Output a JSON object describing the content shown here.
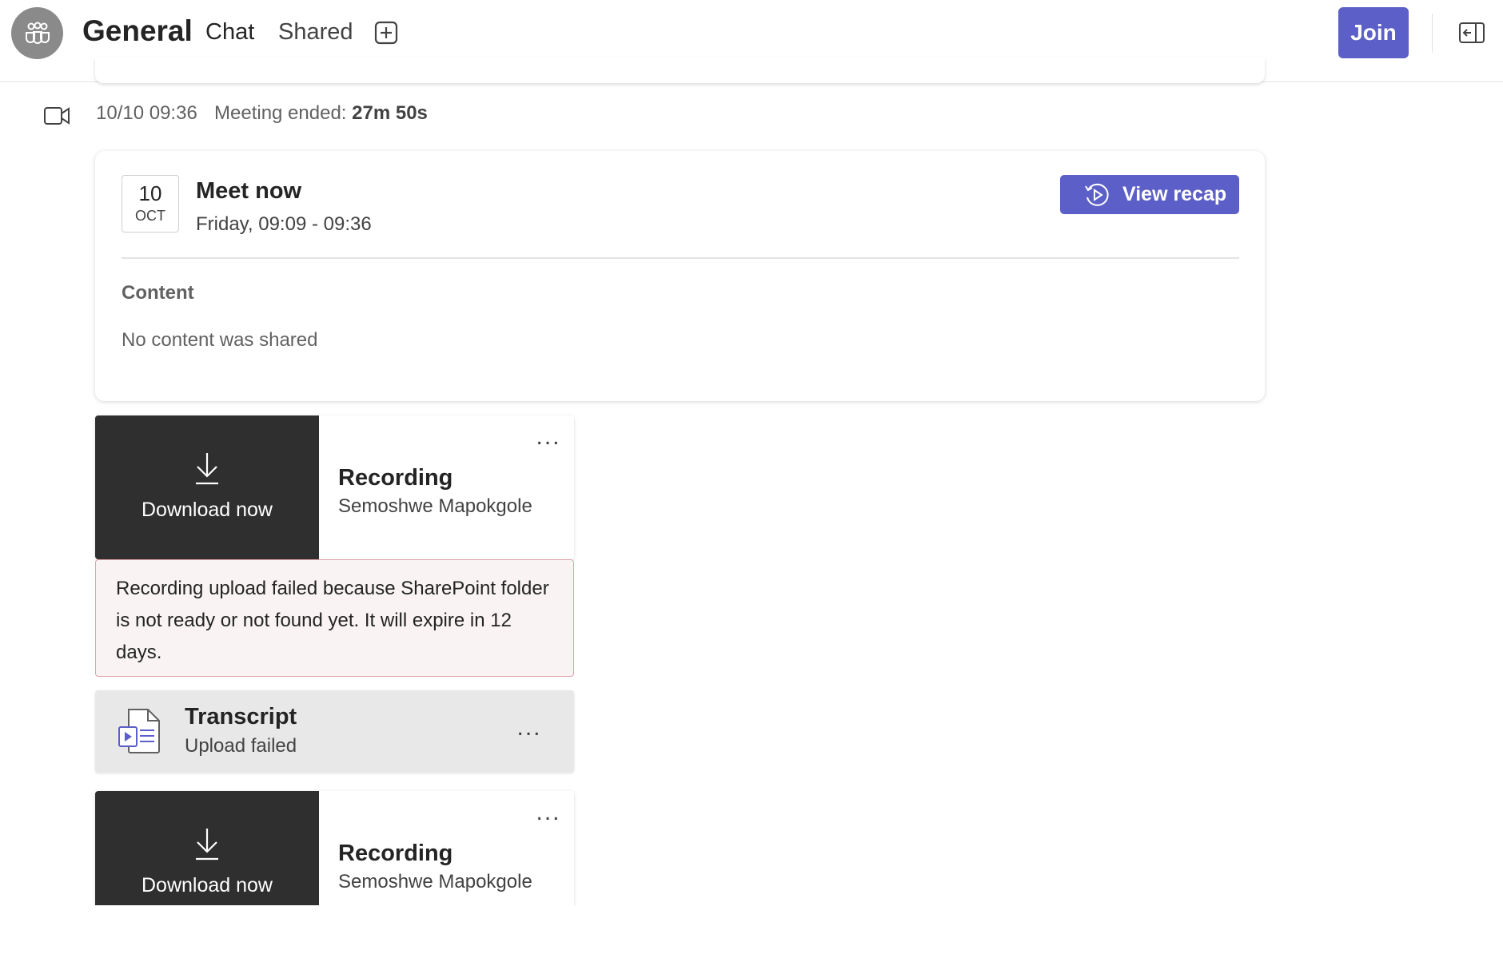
{
  "header": {
    "channel_name": "General",
    "tabs": [
      {
        "label": "Chat",
        "active": true
      },
      {
        "label": "Shared",
        "active": false
      }
    ],
    "join_label": "Join",
    "accent_color": "#5b5fc7"
  },
  "meeting_event": {
    "timestamp": "10/10 09:36",
    "ended_label": "Meeting ended:",
    "duration": "27m 50s"
  },
  "meeting_card": {
    "date_day": "10",
    "date_month": "OCT",
    "title": "Meet now",
    "time_range": "Friday, 09:09 - 09:36",
    "recap_label": "View recap",
    "content_heading": "Content",
    "content_empty": "No content was shared"
  },
  "recordings": [
    {
      "download_label": "Download now",
      "title": "Recording",
      "owner": "Semoshwe Mapokgole"
    },
    {
      "download_label": "Download now",
      "title": "Recording",
      "owner": "Semoshwe Mapokgole"
    }
  ],
  "upload_error": "Recording upload failed because SharePoint folder is not ready or not found yet. It will expire in 12 days.",
  "transcript": {
    "title": "Transcript",
    "status": "Upload failed"
  },
  "more_options": "..."
}
